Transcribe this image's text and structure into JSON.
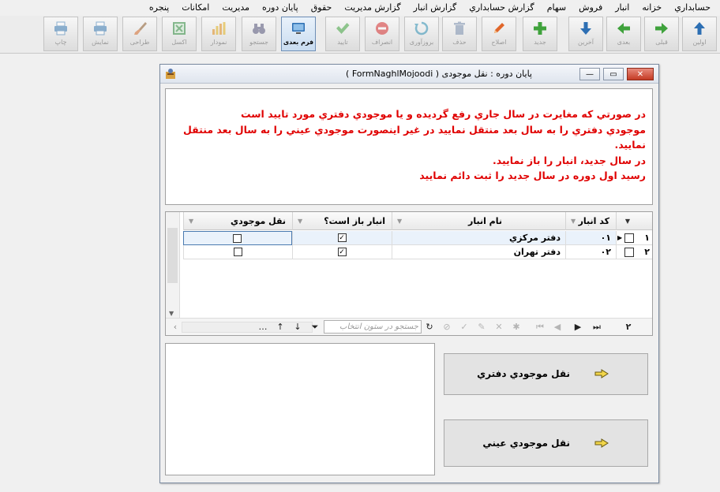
{
  "menu": [
    "حسابداري",
    "خزانه",
    "انبار",
    "فروش",
    "سهام",
    "گزارش حسابداري",
    "گزارش انبار",
    "گزارش مديريت",
    "حقوق",
    "پايان دوره",
    "مديريت",
    "امکانات",
    "پنجره"
  ],
  "toolbar": {
    "buttons": [
      {
        "label": "اولین",
        "icon": "arrow-up-icon",
        "color": "#2d6fb3"
      },
      {
        "label": "قبلی",
        "icon": "arrow-right-icon",
        "color": "#3fa23c"
      },
      {
        "label": "بعدی",
        "icon": "arrow-left-icon",
        "color": "#3fa23c"
      },
      {
        "label": "آخرین",
        "icon": "arrow-down-icon",
        "color": "#2d6fb3"
      },
      {
        "label": "جدید",
        "icon": "plus-icon",
        "color": "#3fa23c"
      },
      {
        "label": "اصلاح",
        "icon": "pencil-icon",
        "color": "#e0662a"
      },
      {
        "label": "حذف",
        "icon": "trash-icon",
        "color": "#7a8fae"
      },
      {
        "label": "بروزآوری",
        "icon": "refresh-icon",
        "color": "#2d8fb3"
      },
      {
        "label": "انصراف",
        "icon": "cancel-icon",
        "color": "#d42d2d"
      },
      {
        "label": "تایید",
        "icon": "check-icon",
        "color": "#3fa23c"
      },
      {
        "label": "فرم بعدی",
        "icon": "monitor-icon",
        "color": "#2d6fb3"
      },
      {
        "label": "جستجو",
        "icon": "binoculars-icon",
        "color": "#55557a"
      },
      {
        "label": "نمودار",
        "icon": "bar-chart-icon",
        "color": "#e08a1a"
      },
      {
        "label": "اکسل",
        "icon": "excel-icon",
        "color": "#2e8b3d"
      },
      {
        "label": "طراحی",
        "icon": "brush-icon",
        "color": "#d46a2a"
      },
      {
        "label": "نمایش",
        "icon": "printer-preview-icon",
        "color": "#3a7ab3"
      },
      {
        "label": "چاپ",
        "icon": "printer-icon",
        "color": "#3a7ab3"
      }
    ],
    "active_label": "فرم بعدی"
  },
  "window": {
    "title": "پایان دوره : نقل موجودی ( FormNaghlMojoodi )",
    "minimize": "—",
    "restore": "▭",
    "close": "✕"
  },
  "message_lines": [
    "در صورتي که مغايرت در سال جاري رفع گرديده و يا موجودي دفتري مورد تاييد است",
    "موجودي دفتري را به سال بعد منتقل نماييد در غير اينصورت موجودي عيني را به سال بعد منتقل",
    "نماييد.",
    "در سال جديد، انبار را باز نماييد.",
    "رسيد اول دوره در سال جديد را ثبت دائم نماييد"
  ],
  "grid": {
    "columns": [
      "کد انبار",
      "نام انبار",
      "انبار باز است؟",
      "نقل موجودي"
    ],
    "rows": [
      {
        "num": "١",
        "code": "٠١",
        "name": "دفتر مرکزي",
        "open": true,
        "transfer": false
      },
      {
        "num": "٢",
        "code": "٠٢",
        "name": "دفتر تهران",
        "open": true,
        "transfer": false
      }
    ],
    "row_count": "٢",
    "search_placeholder": "جستجو در ستون انتخاب"
  },
  "actions": {
    "book_transfer": "نقل موجودي دفتري",
    "physical_transfer": "نقل موجودي عيني"
  }
}
